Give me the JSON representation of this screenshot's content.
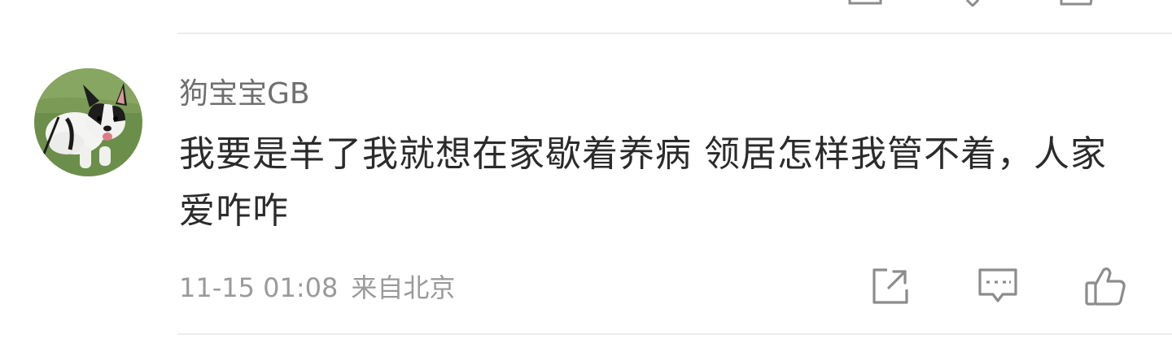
{
  "comment": {
    "username": "狗宝宝GB",
    "text": "我要是羊了我就想在家歇着养病 领居怎样我管不着，人家爱咋咋",
    "timestamp": "11-15 01:08",
    "location": "来自北京"
  },
  "actions": {
    "share_icon": "share-icon",
    "reply_icon": "comment-icon",
    "like_icon": "thumbs-up-icon"
  },
  "colors": {
    "username": "#6f6f6f",
    "text": "#2b2b2b",
    "meta": "#9a9a9a",
    "icon": "#8c8c8c",
    "divider": "#ececec"
  }
}
